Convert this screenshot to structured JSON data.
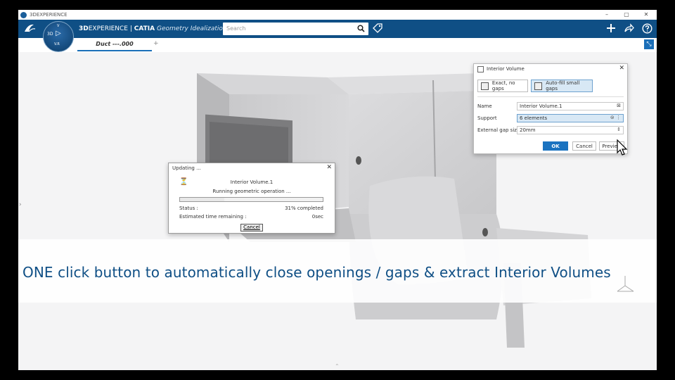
{
  "window": {
    "title": "3DEXPERIENCE",
    "minimize": "–",
    "maximize": "▢",
    "close": "✕"
  },
  "appbar": {
    "logo": "3DS",
    "compass": {
      "label3d": "3D",
      "labelV": "V",
      "labelVR": "V.R"
    },
    "brand_bold": "3D",
    "brand": "EXPERIENCE | ",
    "product": "CATIA",
    "app_name": "Geometry Idealization Ess...",
    "search_placeholder": "Search",
    "icons": [
      "search-icon",
      "tag-icon",
      "plus-icon",
      "share-icon",
      "help-icon"
    ]
  },
  "tabs": {
    "active": "Duct ---.000",
    "add": "+"
  },
  "interior_volume": {
    "title": "Interior Volume",
    "option_exact": "Exact, no gaps",
    "option_autofill": "Auto-fill small gaps",
    "name_label": "Name",
    "name_value": "Interior Volume.1",
    "support_label": "Support",
    "support_value": "6 elements",
    "gap_label": "External gap size",
    "gap_value": "20mm",
    "ok": "OK",
    "cancel": "Cancel",
    "preview": "Preview"
  },
  "updating": {
    "title": "Updating ...",
    "item": "Interior Volume.1",
    "operation": "Running geometric operation ...",
    "progress": 0.31,
    "status_label": "Status :",
    "status_value": "31% completed",
    "eta_label": "Estimated time remaining :",
    "eta_value": "0sec",
    "cancel": "Cancel"
  },
  "banner": {
    "text": "ONE click button to automatically close openings / gaps & extract Interior Volumes"
  },
  "colors": {
    "brand_blue": "#0f4f85",
    "accent": "#1b73c0"
  }
}
